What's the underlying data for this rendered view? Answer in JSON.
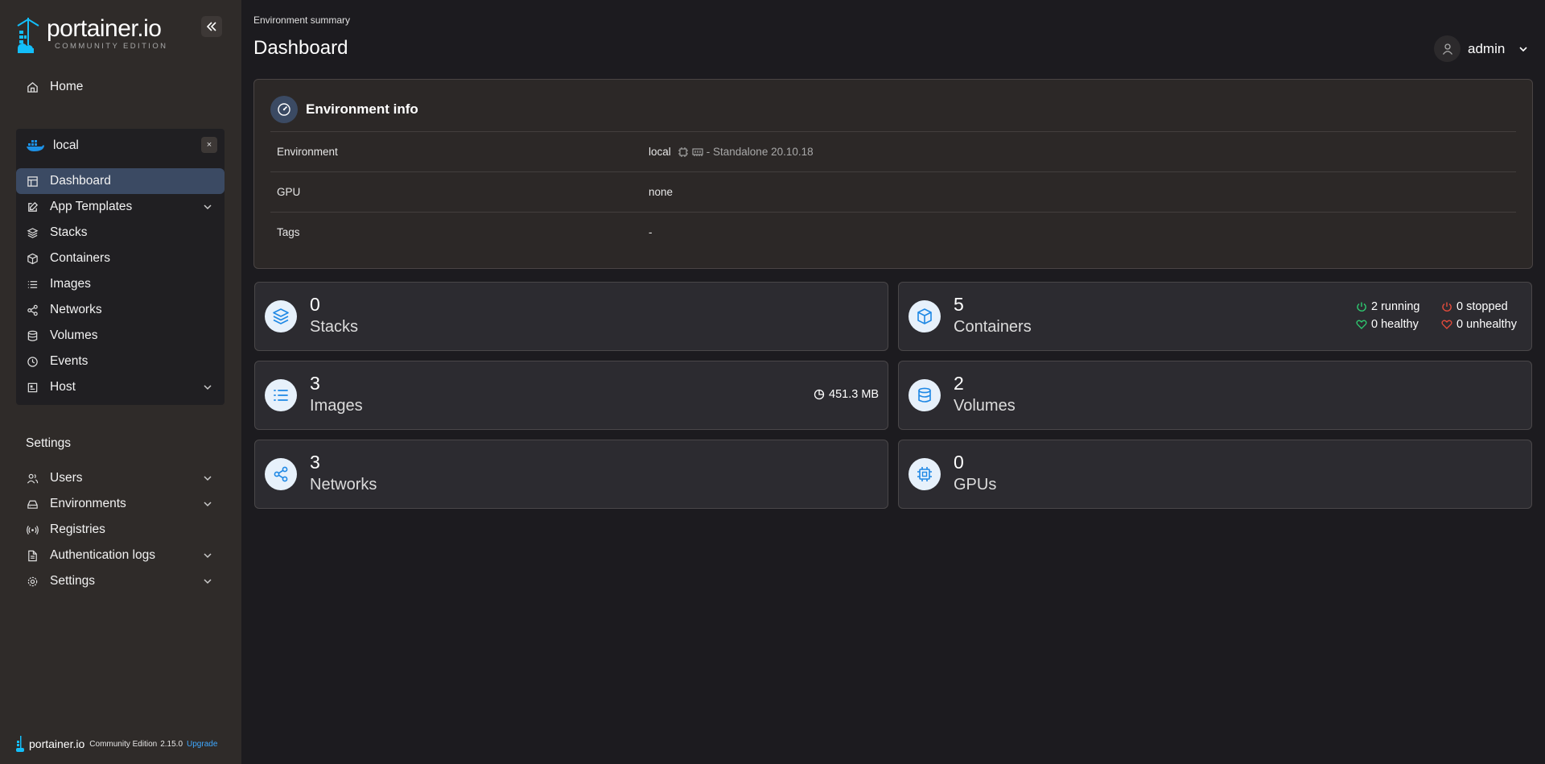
{
  "brand": {
    "name": "portainer.io",
    "edition": "COMMUNITY EDITION"
  },
  "sidebar": {
    "home": "Home",
    "environment": {
      "name": "local",
      "close": "×"
    },
    "env_items": [
      {
        "label": "Dashboard",
        "icon": "layout-icon"
      },
      {
        "label": "App Templates",
        "icon": "edit-icon"
      },
      {
        "label": "Stacks",
        "icon": "layers-icon"
      },
      {
        "label": "Containers",
        "icon": "box-icon"
      },
      {
        "label": "Images",
        "icon": "list-icon"
      },
      {
        "label": "Networks",
        "icon": "share-icon"
      },
      {
        "label": "Volumes",
        "icon": "database-icon"
      },
      {
        "label": "Events",
        "icon": "clock-icon"
      },
      {
        "label": "Host",
        "icon": "server-icon"
      }
    ],
    "settings_title": "Settings",
    "settings_items": [
      {
        "label": "Users",
        "icon": "users-icon"
      },
      {
        "label": "Environments",
        "icon": "hard-drive-icon"
      },
      {
        "label": "Registries",
        "icon": "radio-icon"
      },
      {
        "label": "Authentication logs",
        "icon": "file-text-icon"
      },
      {
        "label": "Settings",
        "icon": "gear-icon"
      }
    ],
    "footer": {
      "name": "portainer.io",
      "edition": "Community Edition",
      "version": "2.15.0",
      "upgrade": "Upgrade"
    }
  },
  "header": {
    "breadcrumb": "Environment summary",
    "title": "Dashboard",
    "user": "admin"
  },
  "env_info": {
    "title": "Environment info",
    "rows": [
      {
        "label": "Environment",
        "value": "local",
        "meta": "- Standalone 20.10.18"
      },
      {
        "label": "GPU",
        "value": "none"
      },
      {
        "label": "Tags",
        "value": "-"
      }
    ]
  },
  "stats": {
    "stacks": {
      "count": "0",
      "label": "Stacks"
    },
    "containers": {
      "count": "5",
      "label": "Containers",
      "running": "2 running",
      "stopped": "0 stopped",
      "healthy": "0 healthy",
      "unhealthy": "0 unhealthy"
    },
    "images": {
      "count": "3",
      "label": "Images",
      "size": "451.3 MB"
    },
    "volumes": {
      "count": "2",
      "label": "Volumes"
    },
    "networks": {
      "count": "3",
      "label": "Networks"
    },
    "gpus": {
      "count": "0",
      "label": "GPUs"
    }
  },
  "colors": {
    "accent": "#3fa8ff",
    "active_bg": "#3b4a63",
    "running": "#2ecc71",
    "stopped": "#e74c3c"
  }
}
